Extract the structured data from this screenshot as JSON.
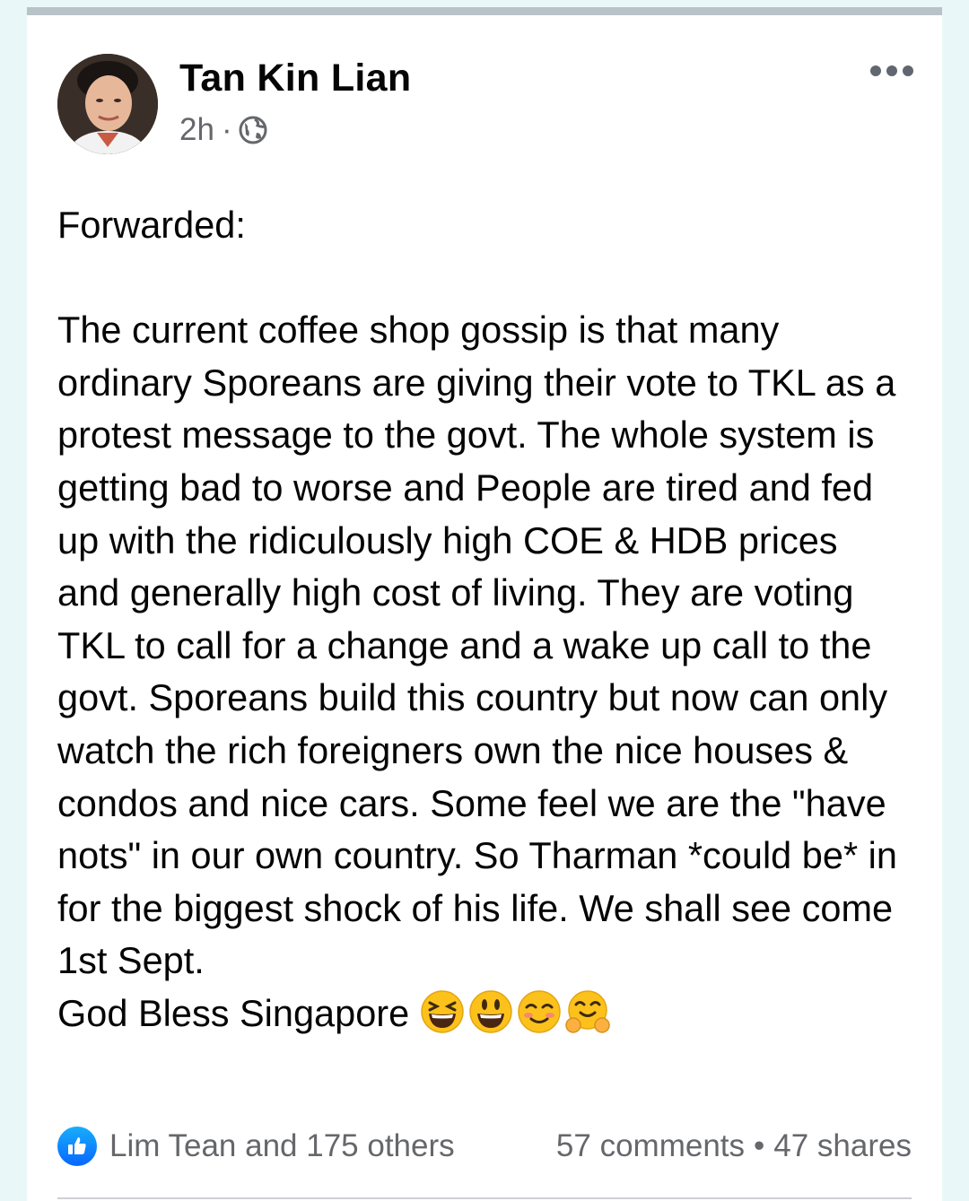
{
  "post": {
    "author": "Tan Kin Lian",
    "time": "2h",
    "separator": "·",
    "privacy_icon": "globe-icon",
    "more_icon": "more-options-icon",
    "body_lines": [
      "Forwarded:",
      "",
      "The current coffee shop gossip is that many ordinary Sporeans are giving their vote to TKL as a protest message to the govt. The whole system is getting bad to worse and People are tired and fed up with the ridiculously high COE & HDB prices and generally high cost of living. They are voting TKL to call for a change and a wake up call to the govt. Sporeans build this country but now can only watch the rich foreigners own the nice houses & condos and nice cars. Some feel we are the \"have nots\" in our own country. So Tharman *could be* in for the biggest shock of his life. We shall see come 1st Sept.",
      "God Bless Singapore"
    ],
    "emojis": [
      "laughing-squint-emoji",
      "grinning-emoji",
      "smiling-blush-emoji",
      "hugging-face-emoji"
    ]
  },
  "footer": {
    "reactions_icon": "like-icon",
    "reactions_text": "Lim Tean and 175 others",
    "comments": "57 comments",
    "dot": "•",
    "shares": "47 shares"
  },
  "colors": {
    "background": "#e9f7f8",
    "card": "#ffffff",
    "text": "#050505",
    "muted": "#65676b",
    "like_blue": "#0866ff"
  }
}
